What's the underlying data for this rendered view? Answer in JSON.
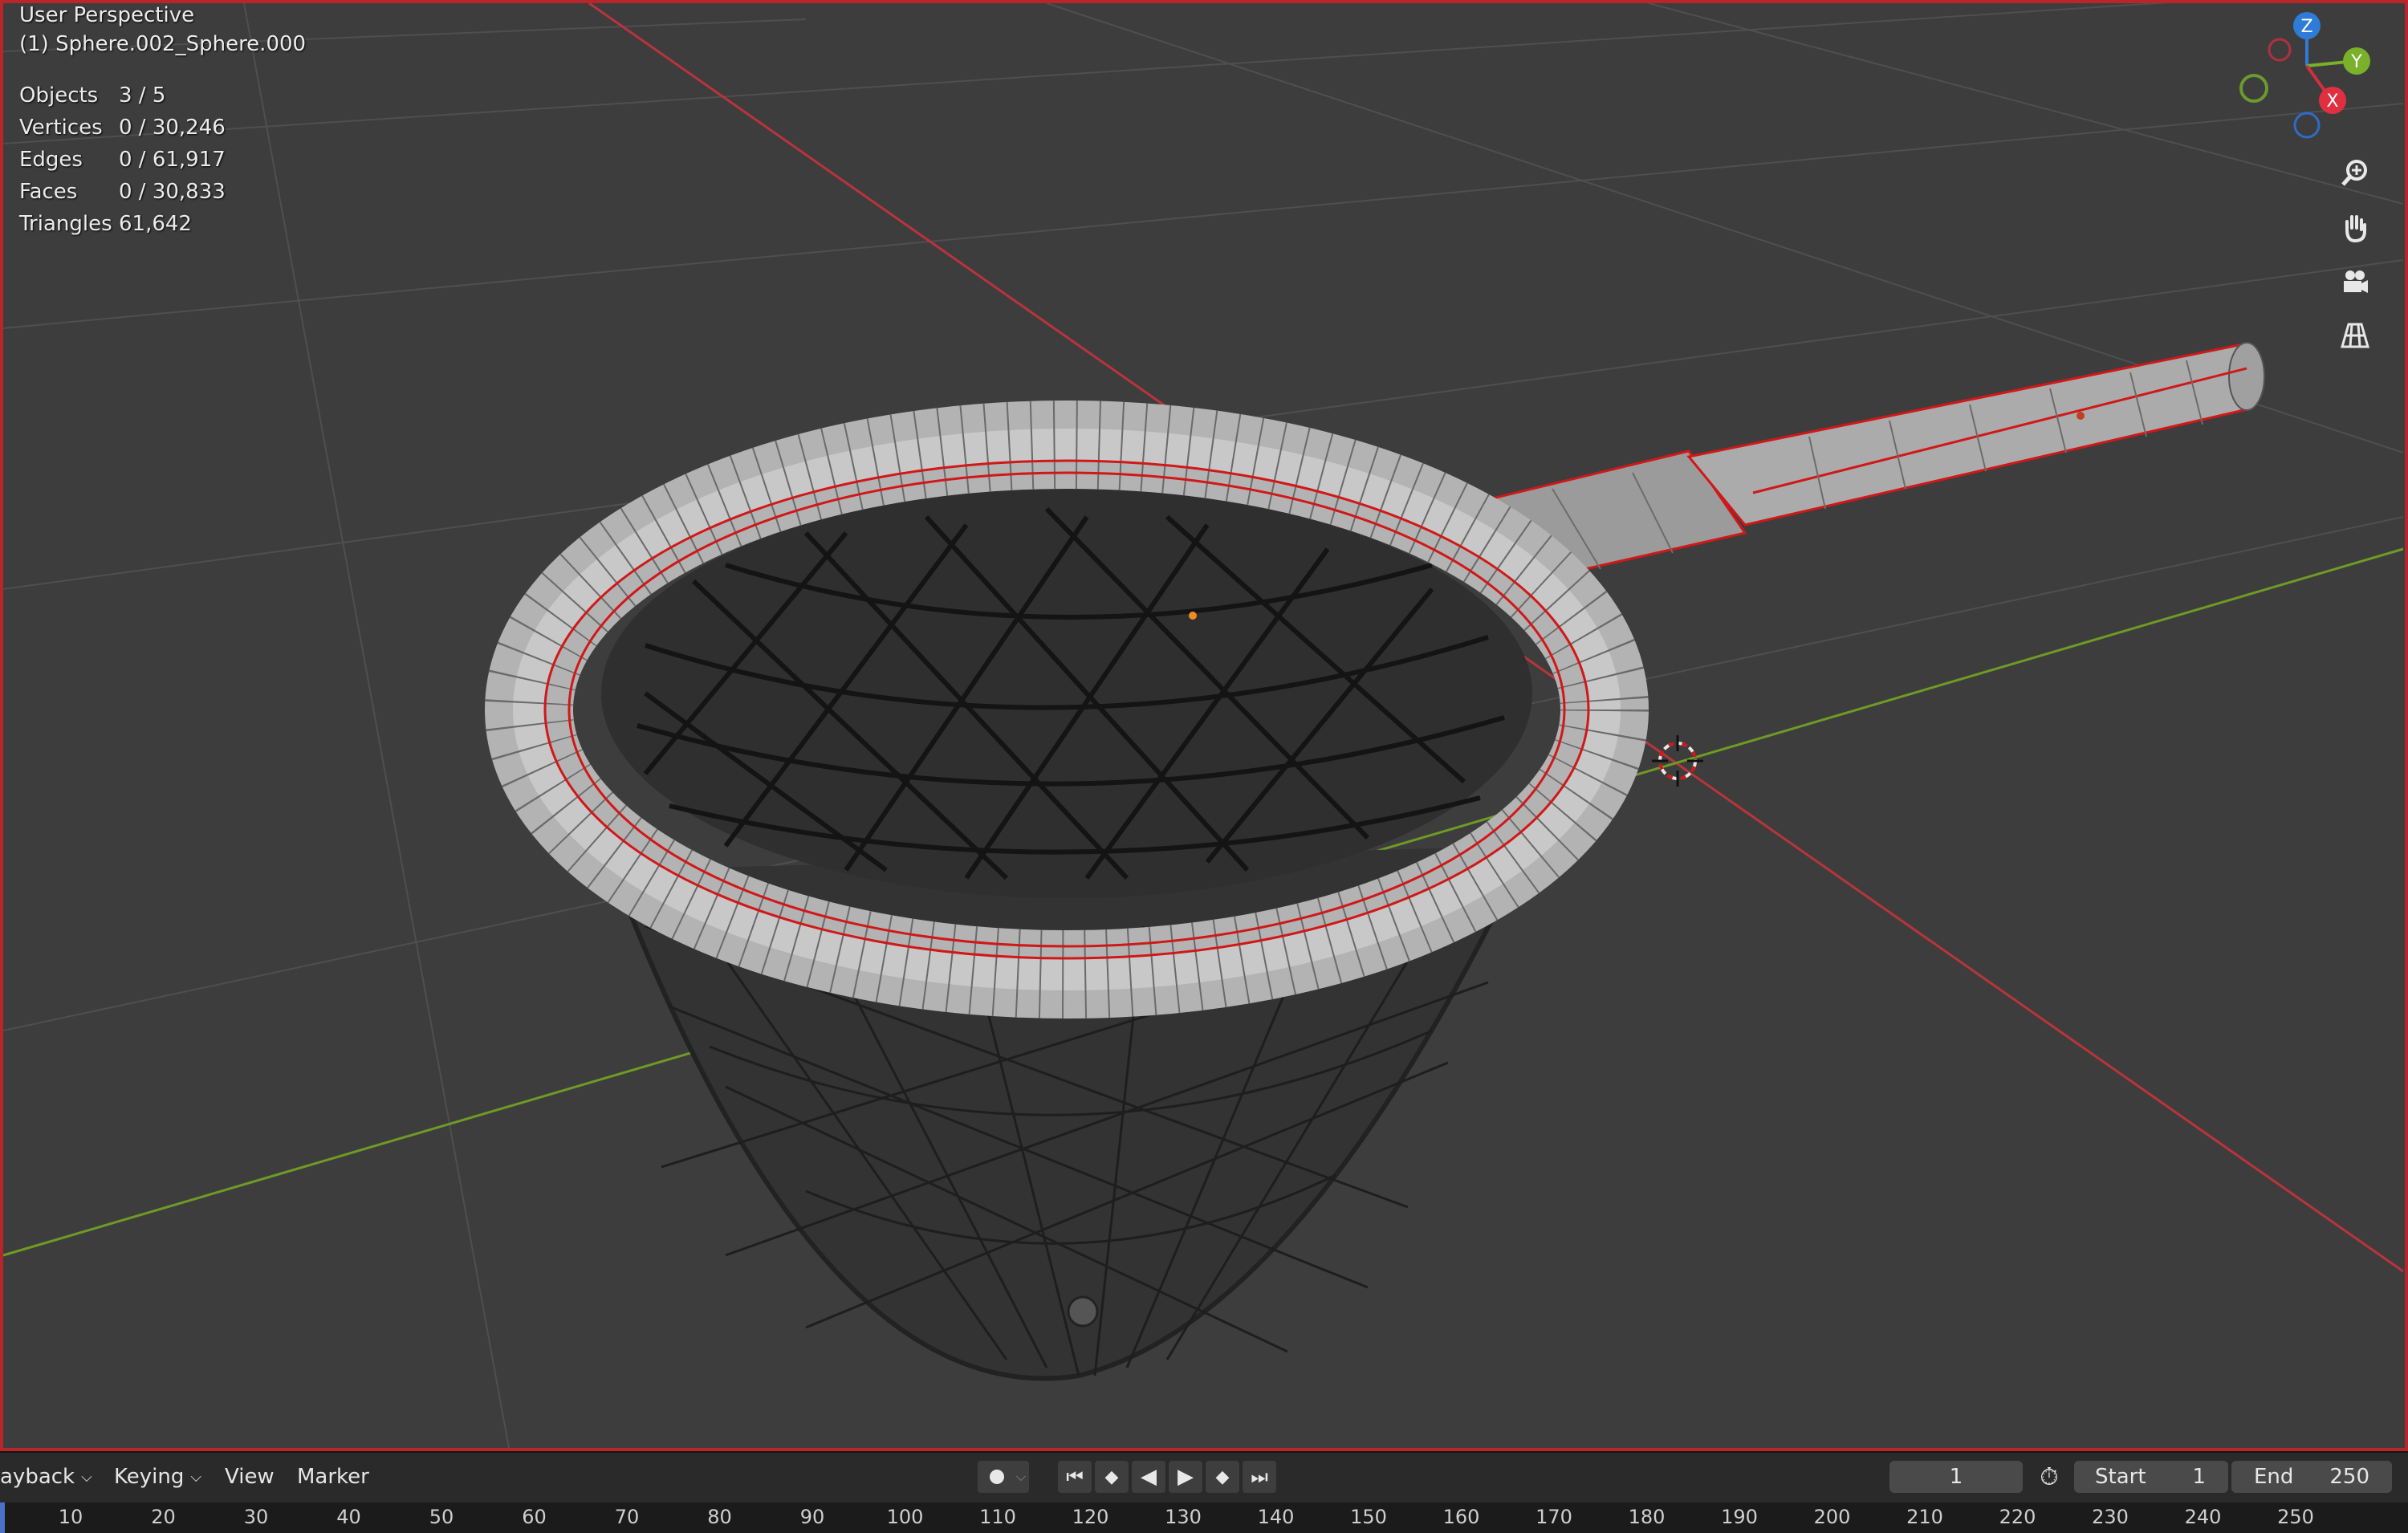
{
  "viewport": {
    "view_name": "User Perspective",
    "object_name": "(1) Sphere.002_Sphere.000",
    "stats": [
      {
        "label": "Objects",
        "value": "3 / 5"
      },
      {
        "label": "Vertices",
        "value": "0 / 30,246"
      },
      {
        "label": "Edges",
        "value": "0 / 61,917"
      },
      {
        "label": "Faces",
        "value": "0 / 30,833"
      },
      {
        "label": "Triangles",
        "value": "61,642"
      }
    ],
    "gizmo": {
      "z": "Z",
      "y": "Y",
      "x": "X"
    },
    "nav_icons": [
      "zoom-icon",
      "hand-pan-icon",
      "camera-icon",
      "grid-perspective-icon"
    ],
    "colors": {
      "background": "#3d3d3d",
      "x_axis": "#c0303a",
      "y_axis": "#7aa12a",
      "selection_outline": "#d01818",
      "mesh": "#bdbdbd"
    }
  },
  "timeline": {
    "menus": {
      "playback": "ayback",
      "keying": "Keying",
      "view": "View",
      "marker": "Marker"
    },
    "current_frame": "1",
    "start_label": "Start",
    "start_value": "1",
    "end_label": "End",
    "end_value": "250",
    "ruler_ticks": [
      "10",
      "20",
      "30",
      "40",
      "50",
      "60",
      "70",
      "80",
      "90",
      "100",
      "110",
      "120",
      "130",
      "140",
      "150",
      "160",
      "170",
      "180",
      "190",
      "200",
      "210",
      "220",
      "230",
      "240",
      "250"
    ],
    "playback_icons": [
      "record-icon",
      "jump-start-icon",
      "prev-keyframe-icon",
      "play-reverse-icon",
      "play-icon",
      "next-keyframe-icon",
      "jump-end-icon",
      "timer-icon"
    ]
  }
}
